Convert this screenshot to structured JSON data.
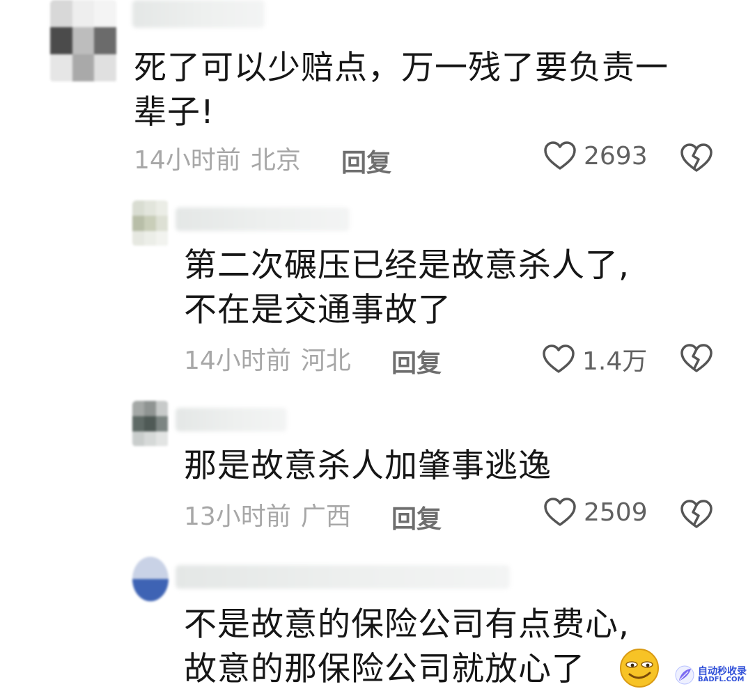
{
  "comments": [
    {
      "text": "死了可以少赔点，万一残了要负责一\n辈子!",
      "time": "14小时前",
      "location": "北京",
      "reply_label": "回复",
      "likes": "2693"
    },
    {
      "text": "第二次碾压已经是故意杀人了,\n不在是交通事故了",
      "time": "14小时前",
      "location": "河北",
      "reply_label": "回复",
      "likes": "1.4万"
    },
    {
      "text": "那是故意杀人加肇事逃逸",
      "time": "13小时前",
      "location": "广西",
      "reply_label": "回复",
      "likes": "2509"
    },
    {
      "text": "不是故意的保险公司有点费心,\n故意的那保险公司就放心了"
    }
  ],
  "watermark": {
    "line1": "自动秒收录",
    "line2": "BADFL.COM"
  },
  "icons": {
    "like": "heart-outline-icon",
    "dislike": "broken-heart-icon",
    "emoji": "smirk-emoji-icon"
  },
  "colors": {
    "text": "#161616",
    "meta": "#a7a7a7",
    "reply": "#6e6e6e",
    "icon": "#555555",
    "watermark": "#2f4fd8"
  }
}
